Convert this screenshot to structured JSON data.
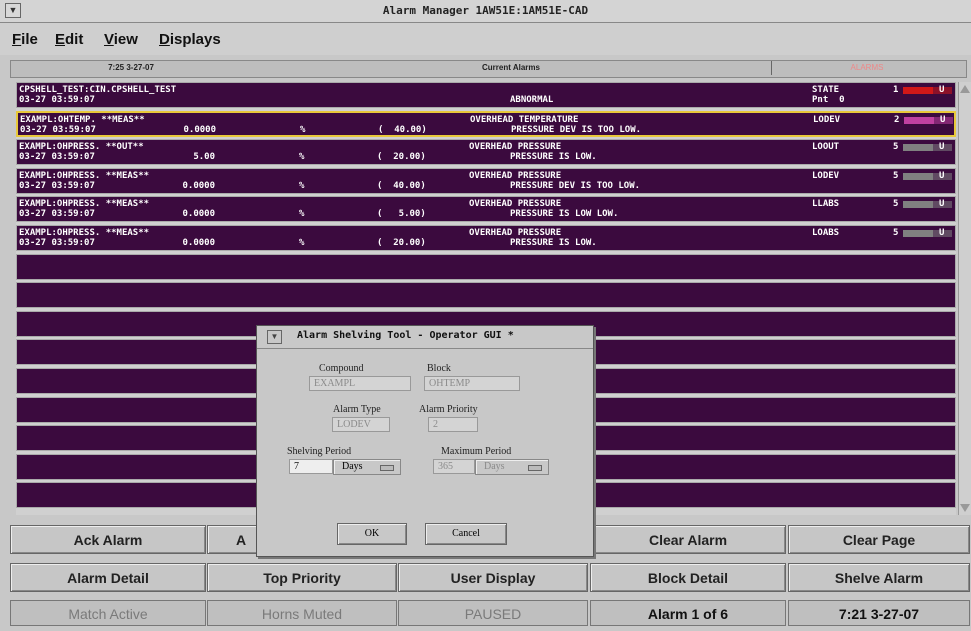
{
  "window": {
    "title": "Alarm Manager 1AW51E:1AM51E-CAD"
  },
  "menu": {
    "items": [
      {
        "label": "File",
        "u": "F",
        "rest": "ile"
      },
      {
        "label": "Edit",
        "u": "E",
        "rest": "dit"
      },
      {
        "label": "View",
        "u": "V",
        "rest": "iew"
      },
      {
        "label": "Displays",
        "u": "D",
        "rest": "isplays"
      }
    ]
  },
  "info": {
    "time": "7:25 3-27-07",
    "view": "Current Alarms",
    "alarms_label": "ALARMS"
  },
  "alarms": [
    {
      "line1": "CPSHELL_TEST:CIN.CPSHELL_TEST",
      "line2": "03-27 03:59:07",
      "value": "",
      "unit": "",
      "limit": "",
      "desc1": "",
      "desc2": "ABNORMAL",
      "type1": "STATE",
      "type2": "Pnt  0",
      "priority": "1",
      "flag": "U",
      "prio_color": "#d01818"
    },
    {
      "line1": "EXAMPL:OHTEMP. **MEAS**",
      "line2": "03-27 03:59:07",
      "value": "0.0000",
      "unit": "%",
      "limit": "(  40.00)",
      "desc1": "OVERHEAD TEMPERATURE",
      "desc2": "PRESSURE DEV IS TOO LOW.",
      "type1": "LODEV",
      "type2": "",
      "priority": "2",
      "flag": "U",
      "prio_color": "#c040a0"
    },
    {
      "line1": "EXAMPL:OHPRESS. **OUT**",
      "line2": "03-27 03:59:07",
      "value": "5.00",
      "unit": "%",
      "limit": "(  20.00)",
      "desc1": "OVERHEAD PRESSURE",
      "desc2": "PRESSURE IS LOW.",
      "type1": "LOOUT",
      "type2": "",
      "priority": "5",
      "flag": "U",
      "prio_color": "#808080"
    },
    {
      "line1": "EXAMPL:OHPRESS. **MEAS**",
      "line2": "03-27 03:59:07",
      "value": "0.0000",
      "unit": "%",
      "limit": "(  40.00)",
      "desc1": "OVERHEAD PRESSURE",
      "desc2": "PRESSURE DEV IS TOO LOW.",
      "type1": "LODEV",
      "type2": "",
      "priority": "5",
      "flag": "U",
      "prio_color": "#808080"
    },
    {
      "line1": "EXAMPL:OHPRESS. **MEAS**",
      "line2": "03-27 03:59:07",
      "value": "0.0000",
      "unit": "%",
      "limit": "(   5.00)",
      "desc1": "OVERHEAD PRESSURE",
      "desc2": "PRESSURE IS LOW LOW.",
      "type1": "LLABS",
      "type2": "",
      "priority": "5",
      "flag": "U",
      "prio_color": "#808080"
    },
    {
      "line1": "EXAMPL:OHPRESS. **MEAS**",
      "line2": "03-27 03:59:07",
      "value": "0.0000",
      "unit": "%",
      "limit": "(  20.00)",
      "desc1": "OVERHEAD PRESSURE",
      "desc2": "PRESSURE IS LOW.",
      "type1": "LOABS",
      "type2": "",
      "priority": "5",
      "flag": "U",
      "prio_color": "#808080"
    }
  ],
  "buttons": {
    "row1": [
      "Ack Alarm",
      "A",
      "",
      "Clear Alarm",
      "Clear Page"
    ],
    "row2": [
      "Alarm Detail",
      "Top Priority",
      "User Display",
      "Block Detail",
      "Shelve Alarm"
    ]
  },
  "status": [
    "Match Active",
    "Horns Muted",
    "PAUSED",
    "Alarm 1 of 6",
    "7:21 3-27-07"
  ],
  "dialog": {
    "title": "Alarm Shelving Tool - Operator GUI *",
    "compound_label": "Compound",
    "compound": "EXAMPL",
    "block_label": "Block",
    "block": "OHTEMP",
    "alarm_type_label": "Alarm Type",
    "alarm_type": "LODEV",
    "alarm_priority_label": "Alarm Priority",
    "alarm_priority": "2",
    "shelving_period_label": "Shelving Period",
    "shelving_period": "7",
    "shelving_unit": "Days",
    "max_period_label": "Maximum Period",
    "max_period": "365",
    "max_unit": "Days",
    "ok": "OK",
    "cancel": "Cancel"
  }
}
